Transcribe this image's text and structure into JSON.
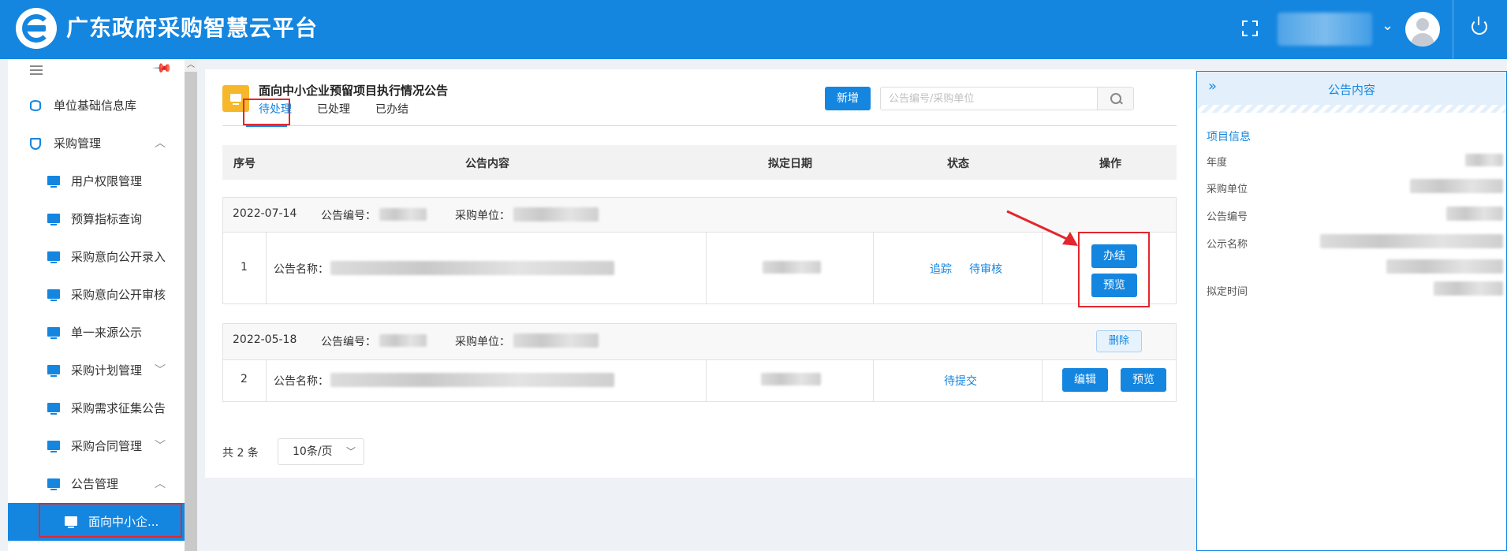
{
  "header": {
    "app_title": "广东政府采购智慧云平台"
  },
  "sidebar": {
    "items": [
      {
        "label": "单位基础信息库"
      },
      {
        "label": "采购管理"
      },
      {
        "label": "用户权限管理"
      },
      {
        "label": "预算指标查询"
      },
      {
        "label": "采购意向公开录入"
      },
      {
        "label": "采购意向公开审核"
      },
      {
        "label": "单一来源公示"
      },
      {
        "label": "采购计划管理"
      },
      {
        "label": "采购需求征集公告"
      },
      {
        "label": "采购合同管理"
      },
      {
        "label": "公告管理"
      },
      {
        "label": "面向中小企..."
      }
    ]
  },
  "main": {
    "page_title": "面向中小企业预留项目执行情况公告",
    "tabs": [
      {
        "label": "待处理"
      },
      {
        "label": "已处理"
      },
      {
        "label": "已办结"
      }
    ],
    "add_label": "新增",
    "search_placeholder": "公告编号/采购单位",
    "columns": [
      "序号",
      "公告内容",
      "拟定日期",
      "状态",
      "操作"
    ],
    "records": [
      {
        "date": "2022-07-14",
        "notice_no_label": "公告编号：",
        "unit_label": "采购单位：",
        "index": "1",
        "name_label": "公告名称：",
        "status_links": [
          "追踪",
          "待审核"
        ],
        "actions": [
          "办结",
          "预览"
        ]
      },
      {
        "date": "2022-05-18",
        "notice_no_label": "公告编号：",
        "unit_label": "采购单位：",
        "delete_label": "删除",
        "index": "2",
        "name_label": "公告名称：",
        "status_links": [
          "待提交"
        ],
        "actions": [
          "编辑",
          "预览"
        ]
      }
    ],
    "pager": {
      "total": "共 2 条",
      "page_size": "10条/页"
    }
  },
  "right_panel": {
    "title": "公告内容",
    "section": "项目信息",
    "fields": [
      "年度",
      "采购单位",
      "公告编号",
      "公示名称",
      "拟定时间"
    ]
  }
}
